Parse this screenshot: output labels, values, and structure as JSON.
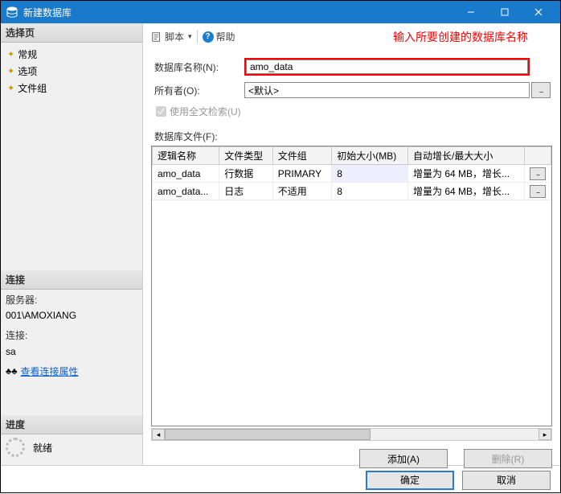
{
  "window": {
    "title": "新建数据库",
    "minimize_tip": "minimize",
    "maximize_tip": "maximize",
    "close_tip": "close"
  },
  "sidebar": {
    "select_page": "选择页",
    "nav": [
      {
        "icon": "star",
        "label": "常规"
      },
      {
        "icon": "star",
        "label": "选项"
      },
      {
        "icon": "star",
        "label": "文件组"
      }
    ],
    "connection_header": "连接",
    "server_label": "服务器:",
    "server_value": "001\\AMOXIANG",
    "conn_label": "连接:",
    "conn_value": "sa",
    "view_props_link": "查看连接属性",
    "progress_header": "进度",
    "status": "就绪"
  },
  "toolstrip": {
    "script": "脚本",
    "help": "帮助"
  },
  "annotation": "输入所要创建的数据库名称",
  "form": {
    "dbname_label": "数据库名称(N):",
    "dbname_value": "amo_data",
    "owner_label": "所有者(O):",
    "owner_value": "<默认>",
    "fulltext_label": "使用全文检索(U)"
  },
  "files": {
    "section_label": "数据库文件(F):",
    "columns": [
      "逻辑名称",
      "文件类型",
      "文件组",
      "初始大小(MB)",
      "自动增长/最大大小"
    ],
    "rows": [
      {
        "name": "amo_data",
        "type": "行数据",
        "group": "PRIMARY",
        "initsize": "8",
        "growth": "增量为 64 MB，增长..."
      },
      {
        "name": "amo_data...",
        "type": "日志",
        "group": "不适用",
        "initsize": "8",
        "growth": "增量为 64 MB，增长..."
      }
    ],
    "add_btn": "添加(A)",
    "remove_btn": "删除(R)"
  },
  "footer": {
    "ok": "确定",
    "cancel": "取消"
  }
}
